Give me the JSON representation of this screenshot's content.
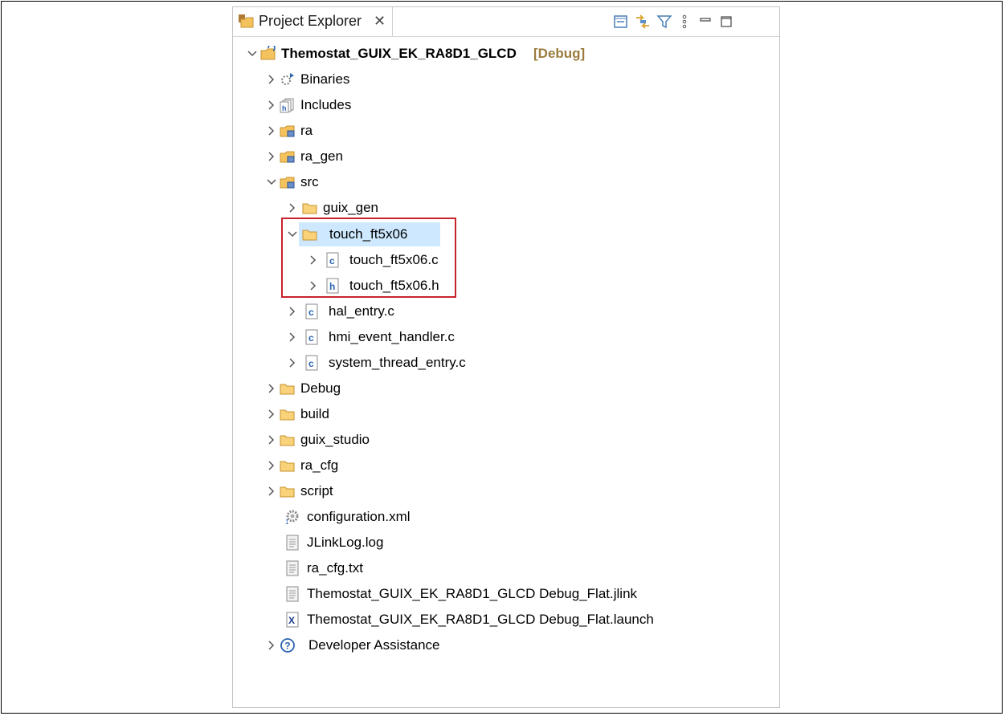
{
  "tab": {
    "title": "Project Explorer",
    "close_icon": "close-icon",
    "toolbar_icons": [
      "collapse-all-icon",
      "link-with-editor-icon",
      "filter-icon",
      "view-menu-icon",
      "minimize-icon",
      "maximize-icon"
    ]
  },
  "tree": {
    "project": {
      "name": "Themostat_GUIX_EK_RA8D1_GLCD",
      "badge": "[Debug]"
    },
    "binaries": "Binaries",
    "includes": "Includes",
    "ra": "ra",
    "ra_gen": "ra_gen",
    "src": "src",
    "guix_gen": "guix_gen",
    "touch_folder": "touch_ft5x06",
    "touch_c": "touch_ft5x06.c",
    "touch_h": "touch_ft5x06.h",
    "hal_entry": "hal_entry.c",
    "hmi_handler": "hmi_event_handler.c",
    "system_thread": "system_thread_entry.c",
    "debug": "Debug",
    "build": "build",
    "guix_studio": "guix_studio",
    "ra_cfg": "ra_cfg",
    "script": "script",
    "configuration": "configuration.xml",
    "jlinklog": "JLinkLog.log",
    "ra_cfg_txt": "ra_cfg.txt",
    "jlink_file": "Themostat_GUIX_EK_RA8D1_GLCD Debug_Flat.jlink",
    "launch_file": "Themostat_GUIX_EK_RA8D1_GLCD Debug_Flat.launch",
    "dev_assist": "Developer Assistance"
  }
}
